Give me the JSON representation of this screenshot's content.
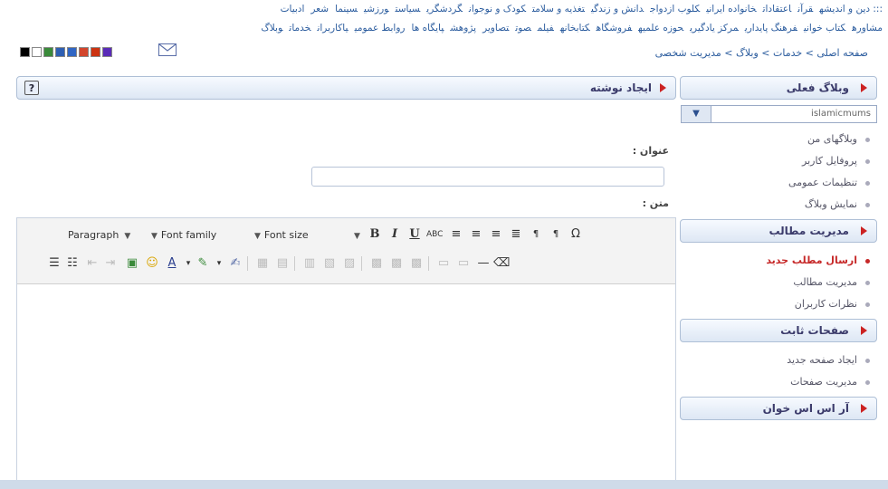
{
  "top_nav": {
    "row1": [
      "::: دین و اندیشه",
      "قرآن",
      "اعتقادات",
      "خانواده ایرانی",
      "کلوب ازدواج",
      "دانش و زندگی",
      "تغذیه و سلامت",
      "کودک و نوجوان",
      "گردشگری",
      "سیاست",
      "ورزشی",
      "سینما",
      "شعر",
      "ادبیات"
    ],
    "row2": [
      "مشاوره",
      "کتاب خوانی",
      "فرهنگ پایداری",
      "مرکز یادگیری",
      "حوزه علمیه",
      "فروشگاه",
      "کتابخانه",
      "فیلم",
      "صوت",
      "تصاویر",
      "پژوهش",
      "پایگاه ها",
      "روابط عمومی",
      "یاکاربران",
      "خدمات",
      "وبلاگ"
    ]
  },
  "theme_colors": [
    "#000000",
    "#ffffff",
    "#3a8a3a",
    "#2e5fb3",
    "#3066c4",
    "#d2452c",
    "#cc3311",
    "#5a2bb8"
  ],
  "mail_icon": "envelope-icon",
  "breadcrumb": "صفحه اصلی > خدمات > وبلاگ > مدیریت شخصی",
  "sidebar": {
    "section1": {
      "title": "وبلاگ فعلی",
      "select_value": "islamicmums",
      "items": [
        "وبلاگهای من",
        "پروفایل کاربر",
        "تنظیمات عمومی",
        "نمایش وبلاگ"
      ]
    },
    "section2": {
      "title": "مدیریت مطالب",
      "items": [
        "ارسال مطلب جدید",
        "مدیریت مطالب",
        "نظرات کاربران"
      ]
    },
    "section3": {
      "title": "صفحات ثابت",
      "items": [
        "ایجاد صفحه جدید",
        "مدیریت صفحات"
      ]
    },
    "section4": {
      "title": "آر اس اس خوان"
    }
  },
  "main": {
    "title": "ایجاد نوشته",
    "help_label": "?",
    "title_label": "عنوان :",
    "body_label": "متن :",
    "editor": {
      "format_select": "Paragraph",
      "font_family_select": "Font family",
      "font_size_select": "Font size"
    }
  }
}
